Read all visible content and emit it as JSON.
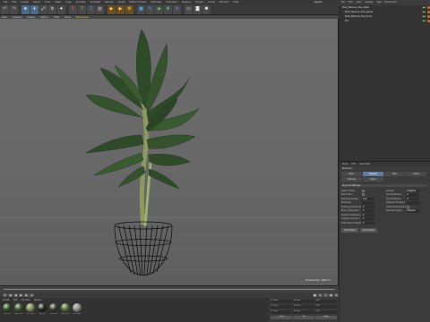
{
  "menubar": [
    "File",
    "Edit",
    "Create",
    "Select",
    "Tools",
    "Mesh",
    "Snap",
    "Animate",
    "Simulate",
    "Render",
    "Sculpt",
    "Motion Tracker",
    "MoGraph",
    "Character",
    "Pipeline",
    "Plugins",
    "Script",
    "Window",
    "Help"
  ],
  "layout_label": "Layout:",
  "toolbar_icons": [
    {
      "name": "undo-icon",
      "glyph": "↶",
      "color": "#c9c9c9",
      "bg": "#4a4a4a"
    },
    {
      "name": "redo-icon",
      "glyph": "↷",
      "color": "#c9c9c9",
      "bg": "#4a4a4a"
    },
    {
      "name": "live-select-icon",
      "glyph": "➤",
      "color": "#ffffff",
      "bg": "#4a6a8a"
    },
    {
      "name": "move-icon",
      "glyph": "✛",
      "color": "#ffffff",
      "bg": "#4a6a8a"
    },
    {
      "name": "scale-icon",
      "glyph": "⤢",
      "color": "#ffffff",
      "bg": "#4a4a4a"
    },
    {
      "name": "rotate-icon",
      "glyph": "↻",
      "color": "#ffffff",
      "bg": "#4a4a4a"
    },
    {
      "name": "recent-tools-icon",
      "glyph": "✦",
      "color": "#ffffff",
      "bg": "#4a4a4a"
    },
    {
      "name": "x-axis-icon",
      "glyph": "X",
      "color": "#e05050",
      "bg": "#4a4a4a"
    },
    {
      "name": "y-axis-icon",
      "glyph": "Y",
      "color": "#60c060",
      "bg": "#4a4a4a"
    },
    {
      "name": "z-axis-icon",
      "glyph": "Z",
      "color": "#5080e0",
      "bg": "#4a4a4a"
    },
    {
      "name": "coord-system-icon",
      "glyph": "◎",
      "color": "#ffffff",
      "bg": "#4a4a4a"
    },
    {
      "name": "render-view-icon",
      "glyph": "▶",
      "color": "#ffd060",
      "bg": "#6a5020"
    },
    {
      "name": "render-picture-viewer-icon",
      "glyph": "▶",
      "color": "#ffd060",
      "bg": "#6a5020"
    },
    {
      "name": "render-settings-icon",
      "glyph": "⚙",
      "color": "#ffd060",
      "bg": "#6a5020"
    },
    {
      "name": "cube-icon",
      "glyph": "■",
      "color": "#40a8e8",
      "bg": "#4a4a4a"
    },
    {
      "name": "pen-icon",
      "glyph": "✎",
      "color": "#40a8e8",
      "bg": "#4a4a4a"
    },
    {
      "name": "subdivision-icon",
      "glyph": "◆",
      "color": "#60c060",
      "bg": "#4a4a4a"
    },
    {
      "name": "array-icon",
      "glyph": "✚",
      "color": "#60c060",
      "bg": "#4a4a4a"
    },
    {
      "name": "deformer-icon",
      "glyph": "❖",
      "color": "#9060e0",
      "bg": "#4a4a4a"
    },
    {
      "name": "floor-icon",
      "glyph": "▭",
      "color": "#ffffff",
      "bg": "#4a4a4a"
    },
    {
      "name": "camera-icon",
      "glyph": "◙",
      "color": "#ffffff",
      "bg": "#4a4a4a"
    },
    {
      "name": "light-icon",
      "glyph": "✺",
      "color": "#ffffff",
      "bg": "#4a4a4a"
    }
  ],
  "viewport_menu": [
    "View",
    "Cameras",
    "Display",
    "Options",
    "Filter",
    "Panel"
  ],
  "viewport_label": "Perspective",
  "viewport_footer": "Grid Spacing : 1000 cm",
  "object_manager": {
    "menu": [
      "File",
      "Edit",
      "View",
      "Objects",
      "Tags",
      "Bookmarks"
    ],
    "objects": [
      {
        "name": "Plant_Banana_Tree_(Null)",
        "indent": 0,
        "tag": "#d07030"
      },
      {
        "name": "Plant_Banana_Tree_leaves",
        "indent": 3,
        "tag": "#d07030"
      },
      {
        "name": "Plant_Banana_Tree_trunk",
        "indent": 3,
        "tag": "#d07030"
      },
      {
        "name": "Pot",
        "indent": 3,
        "tag": "#d07030"
      }
    ]
  },
  "attributes": {
    "menu": [
      "Mode",
      "Edit",
      "User Data"
    ],
    "title": "Physical",
    "tabs": [
      "Basic",
      "Physical",
      "Filter",
      "Global",
      "Textures",
      "Depth"
    ],
    "active_tab": "Physical",
    "section": "Physical Settings",
    "left_rows": [
      {
        "label": "Depth of Field",
        "value": "",
        "kind": "check"
      },
      {
        "label": "Motion Blur",
        "value": "",
        "kind": "check"
      },
      {
        "label": "Sampling Quality",
        "value": "Low",
        "kind": "field"
      },
      {
        "label": "Blurriness",
        "value": "",
        "kind": "field"
      },
      {
        "label": "Shading Subdivision",
        "value": "0",
        "kind": "field"
      },
      {
        "label": "Blurry Subdivision",
        "value": "0",
        "kind": "field"
      },
      {
        "label": "Shadow Subdivision",
        "value": "0",
        "kind": "field"
      },
      {
        "label": "Ambient Occlusion",
        "value": "0",
        "kind": "field"
      },
      {
        "label": "Subsurface Scattering",
        "value": "0",
        "kind": "field"
      }
    ],
    "right_rows": [
      {
        "label": "Sampler",
        "value": "Adaptive",
        "kind": "field"
      },
      {
        "label": "Max Subdivision",
        "value": "4",
        "kind": "field"
      },
      {
        "label": "Min Subdivision",
        "value": "2",
        "kind": "field"
      },
      {
        "label": "Adaptive Threshold",
        "value": "",
        "kind": "field"
      },
      {
        "label": "Detail Enhancement",
        "value": "",
        "kind": "check"
      },
      {
        "label": "Raytrace Engine",
        "value": "Physical",
        "kind": "field"
      }
    ],
    "buttons": [
      "Load Preset",
      "Save Preset"
    ]
  },
  "timeline_controls": [
    "⏮",
    "◀",
    "◀",
    "▶",
    "▶",
    "⏭",
    "●",
    "◎",
    "⚿",
    "▣",
    "⊕"
  ],
  "materials": {
    "menu": [
      "Create",
      "Edit",
      "Function",
      "Texture"
    ],
    "items": [
      {
        "name": "Mat_Leaf",
        "color": "#2f4a2a"
      },
      {
        "name": "Mat_Leaf2",
        "color": "#38532e"
      },
      {
        "name": "Mat_Trunk",
        "color": "#7a8a55"
      },
      {
        "name": "Mat_Pot",
        "color": "#222222"
      },
      {
        "name": "Mat_Soil",
        "color": "#3c3a30"
      },
      {
        "name": "Mat_Stem",
        "color": "#556b3a"
      },
      {
        "name": "Mat_Floor",
        "color": "#8a8a8a"
      }
    ]
  },
  "coordinates": {
    "cells": [
      "X 0 cm",
      "X 0 cm",
      "H 0°",
      "Y 0 cm",
      "Y 0 cm",
      "P 0°",
      "Z 0 cm",
      "Z 0 cm",
      "B 0°",
      "Object",
      "Size",
      "Apply"
    ]
  },
  "colors": {
    "accent": "#5e7ea6",
    "viewport_bg": "#6a6a6a",
    "leaf": "#2f4a2a",
    "trunk": "#8a9a5a",
    "pot": "#1a1a1a"
  }
}
